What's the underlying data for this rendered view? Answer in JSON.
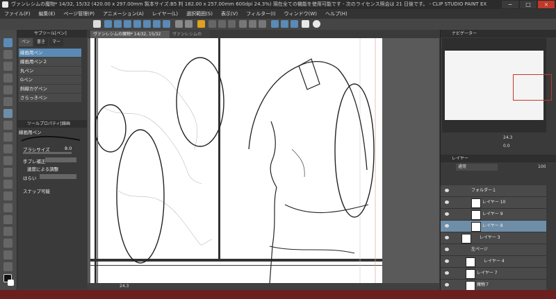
{
  "window": {
    "title": "ヴァンレシムの魔物* 14/32, 15/32 (420.00 x 297.00mm 製本サイズ:B5 判 182.00 x 257.00mm 600dpi 24.3%)  現在全ての機能を使用可能です - 次のライセンス照会は 21 日後です。 - CLIP STUDIO PAINT EX",
    "minimize": "−",
    "maximize": "□",
    "close": "×"
  },
  "menu": [
    "ファイル(F)",
    "編集(E)",
    "ページ管理(P)",
    "アニメーション(A)",
    "レイヤー(L)",
    "選択範囲(S)",
    "表示(V)",
    "フィルター(I)",
    "ウィンドウ(W)",
    "ヘルプ(H)"
  ],
  "doc_tabs": {
    "active": "ヴァンレシムの魔物* 14/32, 15/32",
    "inactive": "ヴァンレシムの"
  },
  "subtool_panel": {
    "title": "サブツール[ペン]",
    "tabs": [
      "ペン",
      "書き",
      "マー"
    ],
    "items": [
      "線画用ペン",
      "線画用ペン２",
      "丸ペン",
      "Gペン",
      "斜線カゲペン",
      "さらっきペン"
    ]
  },
  "tool_property": {
    "title": "ツールプロパティ[線画",
    "brush_name": "線画用ペン",
    "brush_size_label": "ブラシサイズ",
    "brush_size_value": "8.0",
    "stabilization_label": "手ブレ補正",
    "speed_adjust_label": "速度による調整",
    "pressure_label": "はらい",
    "snap_label": "スナップ可能"
  },
  "navigator": {
    "title": "ナビゲーター",
    "zoom": "24.3",
    "rotation": "0.0"
  },
  "layer_panel": {
    "title": "レイヤー",
    "blend_mode": "通常",
    "opacity": "100",
    "layers": [
      {
        "name": "フォルダー１",
        "kind": "folder"
      },
      {
        "name": "レイヤー 10",
        "kind": "layer"
      },
      {
        "name": "レイヤー 9",
        "kind": "layer"
      },
      {
        "name": "レイヤー 8",
        "kind": "layer",
        "selected": true
      },
      {
        "name": "レイヤー 3",
        "kind": "layer"
      },
      {
        "name": "左ページ",
        "kind": "folder"
      },
      {
        "name": "レイヤー 4",
        "kind": "layer"
      },
      {
        "name": "レイヤー 7",
        "kind": "layer"
      },
      {
        "name": "魔物７",
        "kind": "layer"
      }
    ]
  },
  "status": {
    "zoom": "24.3"
  },
  "colors": {
    "accent": "#5a8ab5",
    "selected_layer": "#6e8ea8",
    "title_bg": "#2b2b2b",
    "panel_bg": "#3a3a3a"
  }
}
